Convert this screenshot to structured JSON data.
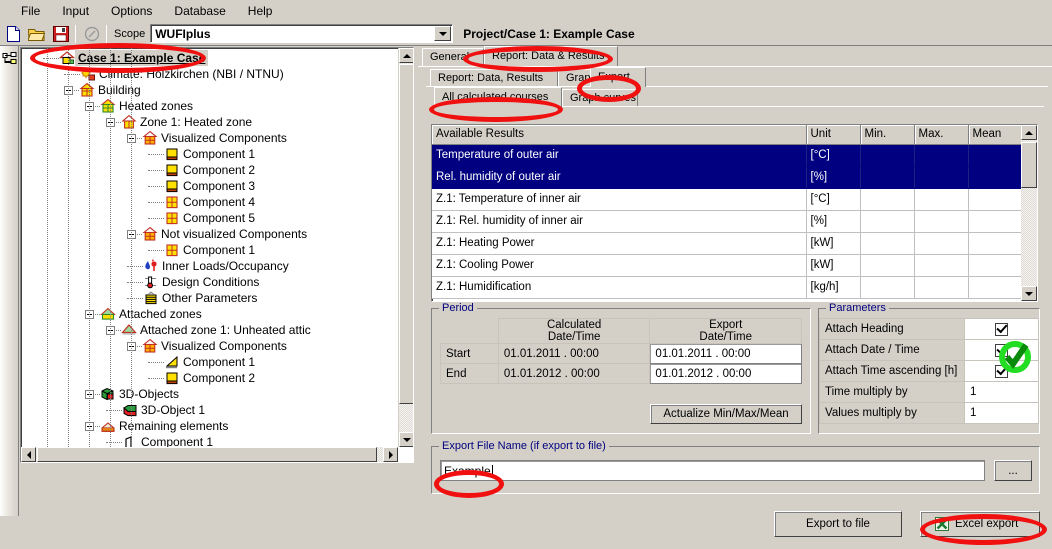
{
  "window": {
    "project_title": "Project/Case 1: Example Case"
  },
  "menubar": {
    "items": [
      {
        "label": "File"
      },
      {
        "label": "Input"
      },
      {
        "label": "Options"
      },
      {
        "label": "Database"
      },
      {
        "label": "Help"
      }
    ]
  },
  "toolbar": {
    "new_icon": "new-document-icon",
    "open_icon": "open-folder-icon",
    "save_icon": "save-disk-icon",
    "info_icon": "info-icon",
    "scope_label": "Scope",
    "scope_value": "WUFIplus",
    "dropdown_icon": "chevron-down-icon"
  },
  "left_strip": {
    "tree_view_icon": "tree-view-icon"
  },
  "tree": {
    "nodes": [
      {
        "label": "Case 1: Example Case",
        "indent": 0,
        "icon": "case-house-icon",
        "expander": false,
        "selected": true
      },
      {
        "label": "Climate: Holzkirchen (NBI / NTNU)",
        "indent": 1,
        "icon": "climate-sun-icon",
        "expander": false,
        "selected": false
      },
      {
        "label": "Building",
        "indent": 1,
        "icon": "building-icon",
        "expander": true,
        "selected": false
      },
      {
        "label": "Heated zones",
        "indent": 2,
        "icon": "heated-zones-icon",
        "expander": true,
        "selected": false
      },
      {
        "label": "Zone 1: Heated zone",
        "indent": 3,
        "icon": "zone-icon",
        "expander": true,
        "selected": false
      },
      {
        "label": "Visualized Components",
        "indent": 4,
        "icon": "visualized-components-icon",
        "expander": true,
        "selected": false
      },
      {
        "label": "Component 1",
        "indent": 5,
        "icon": "component-wall-icon",
        "expander": false,
        "selected": false
      },
      {
        "label": "Component 2",
        "indent": 5,
        "icon": "component-wall-icon",
        "expander": false,
        "selected": false
      },
      {
        "label": "Component 3",
        "indent": 5,
        "icon": "component-wall-icon",
        "expander": false,
        "selected": false
      },
      {
        "label": "Component 4",
        "indent": 5,
        "icon": "component-window-icon",
        "expander": false,
        "selected": false
      },
      {
        "label": "Component 5",
        "indent": 5,
        "icon": "component-window-icon",
        "expander": false,
        "selected": false
      },
      {
        "label": "Not visualized Components",
        "indent": 4,
        "icon": "visualized-components-icon",
        "expander": true,
        "selected": false
      },
      {
        "label": "Component 1",
        "indent": 5,
        "icon": "component-window-icon",
        "expander": false,
        "selected": false
      },
      {
        "label": "Inner Loads/Occupancy",
        "indent": 4,
        "icon": "inner-loads-icon",
        "expander": false,
        "selected": false
      },
      {
        "label": "Design Conditions",
        "indent": 4,
        "icon": "design-conditions-icon",
        "expander": false,
        "selected": false
      },
      {
        "label": "Other Parameters",
        "indent": 4,
        "icon": "other-parameters-icon",
        "expander": false,
        "selected": false
      },
      {
        "label": "Attached zones",
        "indent": 2,
        "icon": "attached-zones-icon",
        "expander": true,
        "selected": false
      },
      {
        "label": "Attached zone 1: Unheated attic",
        "indent": 3,
        "icon": "attic-icon",
        "expander": true,
        "selected": false
      },
      {
        "label": "Visualized Components",
        "indent": 4,
        "icon": "visualized-components-icon",
        "expander": true,
        "selected": false
      },
      {
        "label": "Component 1",
        "indent": 5,
        "icon": "component-slope-icon",
        "expander": false,
        "selected": false
      },
      {
        "label": "Component 2",
        "indent": 5,
        "icon": "component-wall-icon",
        "expander": false,
        "selected": false
      },
      {
        "label": "3D-Objects",
        "indent": 2,
        "icon": "3d-objects-icon",
        "expander": true,
        "selected": false
      },
      {
        "label": "3D-Object 1",
        "indent": 3,
        "icon": "3d-object-icon",
        "expander": false,
        "selected": false
      },
      {
        "label": "Remaining elements",
        "indent": 2,
        "icon": "remaining-elements-icon",
        "expander": true,
        "selected": false
      },
      {
        "label": "Component 1",
        "indent": 3,
        "icon": "remaining-component-icon",
        "expander": false,
        "selected": false
      }
    ]
  },
  "right": {
    "level1_tabs": [
      {
        "label": "General",
        "active": false
      },
      {
        "label": "Report: Data & Results",
        "active": true
      }
    ],
    "level2_tabs": [
      {
        "label": "Report: Data, Results",
        "active": false
      },
      {
        "label": "Graph",
        "active": false
      },
      {
        "label": "Export",
        "active": true
      }
    ],
    "level3_tabs": [
      {
        "label": "All calculated courses",
        "active": true
      },
      {
        "label": "Graph curves",
        "active": false
      }
    ],
    "results_grid": {
      "columns": [
        "Available Results",
        "Unit",
        "Min.",
        "Max.",
        "Mean"
      ],
      "rows": [
        {
          "name": "Temperature of outer air",
          "unit": "[°C]",
          "min": "",
          "max": "",
          "mean": "",
          "selected": true
        },
        {
          "name": "Rel. humidity of outer air",
          "unit": "[%]",
          "min": "",
          "max": "",
          "mean": "",
          "selected": true
        },
        {
          "name": "Z.1: Temperature of inner air",
          "unit": "[°C]",
          "min": "",
          "max": "",
          "mean": "",
          "selected": false
        },
        {
          "name": "Z.1: Rel. humidity of inner air",
          "unit": "[%]",
          "min": "",
          "max": "",
          "mean": "",
          "selected": false
        },
        {
          "name": "Z.1: Heating Power",
          "unit": "[kW]",
          "min": "",
          "max": "",
          "mean": "",
          "selected": false
        },
        {
          "name": "Z.1: Cooling Power",
          "unit": "[kW]",
          "min": "",
          "max": "",
          "mean": "",
          "selected": false
        },
        {
          "name": "Z.1: Humidification",
          "unit": "[kg/h]",
          "min": "",
          "max": "",
          "mean": "",
          "selected": false
        }
      ]
    },
    "period": {
      "group_label": "Period",
      "col_calculated_l1": "Calculated",
      "col_calculated_l2": "Date/Time",
      "col_export_l1": "Export",
      "col_export_l2": "Date/Time",
      "start_label": "Start",
      "start_calculated": "01.01.2011 . 00:00",
      "start_export": "01.01.2011 . 00:00",
      "end_label": "End",
      "end_calculated": "01.01.2012 . 00:00",
      "end_export": "01.01.2012 . 00:00",
      "actualize_button": "Actualize Min/Max/Mean"
    },
    "parameters": {
      "group_label": "Parameters",
      "rows": [
        {
          "label": "Attach Heading",
          "type": "checkbox",
          "checked": true,
          "value": ""
        },
        {
          "label": "Attach Date / Time",
          "type": "checkbox",
          "checked": true,
          "value": "",
          "highlighted": true
        },
        {
          "label": "Attach Time ascending [h]",
          "type": "checkbox",
          "checked": true,
          "value": ""
        },
        {
          "label": "Time multiply by",
          "type": "text",
          "checked": false,
          "value": "1"
        },
        {
          "label": "Values multiply by",
          "type": "text",
          "checked": false,
          "value": "1"
        }
      ]
    },
    "export_file": {
      "group_label": "Export File Name (if export to file)",
      "value": "Example",
      "browse_label": "...",
      "export_to_file_label": "Export to file",
      "excel_export_label": "Excel export",
      "excel_icon": "excel-icon"
    }
  },
  "annotations": {
    "color": "#f01010",
    "highlight_check_color": "#1ec81e",
    "targets": [
      "tree-case-node",
      "report-data-results-tab",
      "export-tab",
      "all-calculated-courses-tab",
      "export-filename-input",
      "excel-export-button",
      "attach-date-time-checkbox"
    ]
  }
}
